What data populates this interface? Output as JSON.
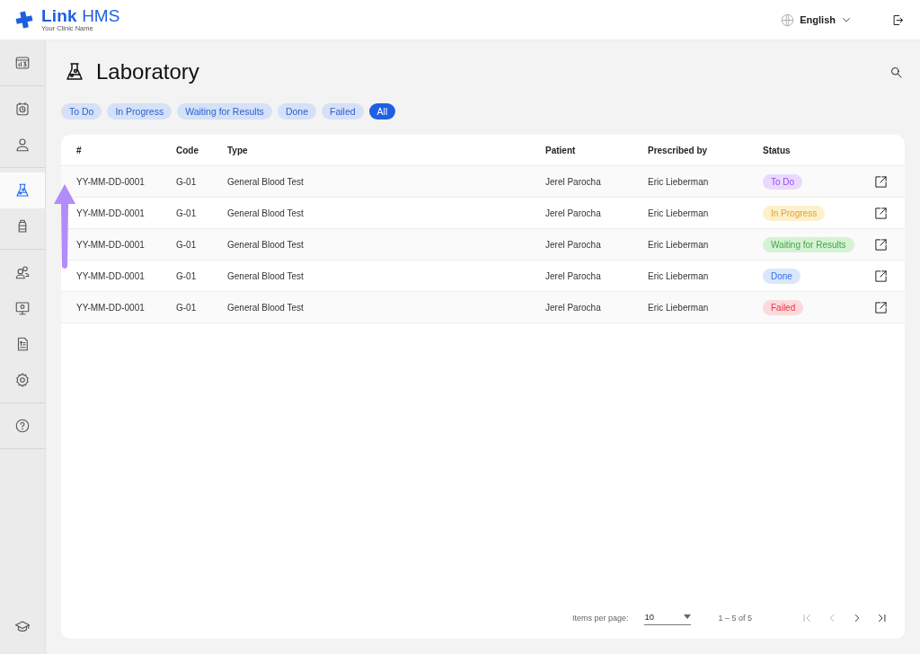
{
  "header": {
    "brand": "Link",
    "brand_suffix": "HMS",
    "clinic": "Your Clinic Name",
    "language": "English"
  },
  "sidebar": {
    "groups": [
      {
        "items": [
          {
            "kind": "dashboard",
            "selected": false
          }
        ]
      },
      {
        "items": [
          {
            "kind": "calendar",
            "selected": false
          },
          {
            "kind": "person",
            "selected": false
          }
        ]
      },
      {
        "items": [
          {
            "kind": "flask",
            "selected": true
          },
          {
            "kind": "bottle",
            "selected": false
          }
        ]
      },
      {
        "items": [
          {
            "kind": "people",
            "selected": false
          },
          {
            "kind": "monitor",
            "selected": false
          },
          {
            "kind": "invoice",
            "selected": false
          },
          {
            "kind": "settings",
            "selected": false
          }
        ]
      },
      {
        "items": [
          {
            "kind": "help",
            "selected": false
          }
        ]
      }
    ],
    "footer": {
      "kind": "cap",
      "selected": false
    }
  },
  "page": {
    "title": "Laboratory"
  },
  "filters": [
    {
      "label": "To Do",
      "selected": false
    },
    {
      "label": "In Progress",
      "selected": false
    },
    {
      "label": "Waiting for Results",
      "selected": false
    },
    {
      "label": "Done",
      "selected": false
    },
    {
      "label": "Failed",
      "selected": false
    },
    {
      "label": "All",
      "selected": true
    }
  ],
  "table": {
    "columns": [
      "#",
      "Code",
      "Type",
      "Patient",
      "Prescribed by",
      "Status"
    ],
    "rows": [
      {
        "id": "YY-MM-DD-0001",
        "code": "G-01",
        "type": "General Blood Test",
        "patient": "Jerel Parocha",
        "prescribed_by": "Eric Lieberman",
        "status": {
          "label": "To Do",
          "kind": "todo"
        }
      },
      {
        "id": "YY-MM-DD-0001",
        "code": "G-01",
        "type": "General Blood Test",
        "patient": "Jerel Parocha",
        "prescribed_by": "Eric Lieberman",
        "status": {
          "label": "In Progress",
          "kind": "progress"
        }
      },
      {
        "id": "YY-MM-DD-0001",
        "code": "G-01",
        "type": "General Blood Test",
        "patient": "Jerel Parocha",
        "prescribed_by": "Eric Lieberman",
        "status": {
          "label": "Waiting for Results",
          "kind": "waiting"
        }
      },
      {
        "id": "YY-MM-DD-0001",
        "code": "G-01",
        "type": "General Blood Test",
        "patient": "Jerel Parocha",
        "prescribed_by": "Eric Lieberman",
        "status": {
          "label": "Done",
          "kind": "done"
        }
      },
      {
        "id": "YY-MM-DD-0001",
        "code": "G-01",
        "type": "General Blood Test",
        "patient": "Jerel Parocha",
        "prescribed_by": "Eric Lieberman",
        "status": {
          "label": "Failed",
          "kind": "failed"
        }
      }
    ]
  },
  "pagination": {
    "label": "Items per page:",
    "page_size": "10",
    "range": "1 – 5 of 5",
    "buttons": [
      {
        "kind": "first",
        "disabled": true
      },
      {
        "kind": "prev",
        "disabled": true
      },
      {
        "kind": "next",
        "disabled": false
      },
      {
        "kind": "last",
        "disabled": false
      }
    ]
  }
}
